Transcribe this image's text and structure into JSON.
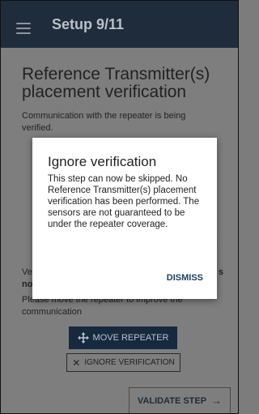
{
  "appbar": {
    "title": "Setup 9/11",
    "menu_icon": "hamburger-menu-icon"
  },
  "page": {
    "title": "Reference Transmitter(s) placement verification",
    "description": "Communication with the repeater is being verified.",
    "warning_fragment_left_1": "Ve",
    "warning_fragment_right": "s",
    "warning_fragment_left_2": "no",
    "warning_text": "Please move the repeater to improve the communication"
  },
  "status_icons": [
    "check-icon",
    "check-icon",
    "x-icon"
  ],
  "buttons": {
    "move_repeater": "MOVE REPEATER",
    "ignore_verification": "IGNORE VERIFICATION",
    "validate_step": "VALIDATE STEP"
  },
  "dialog": {
    "title": "Ignore verification",
    "body": "This step can now be skipped. No Reference Transmitter(s) placement verification has been performed. The sensors are not guaranteed to be under the repeater coverage.",
    "dismiss_label": "DISMISS"
  },
  "colors": {
    "appbar": "#1f2c3b",
    "primary_button": "#17293f",
    "dialog_action": "#1f3f60",
    "overlay_background": "#7e7e7e"
  }
}
